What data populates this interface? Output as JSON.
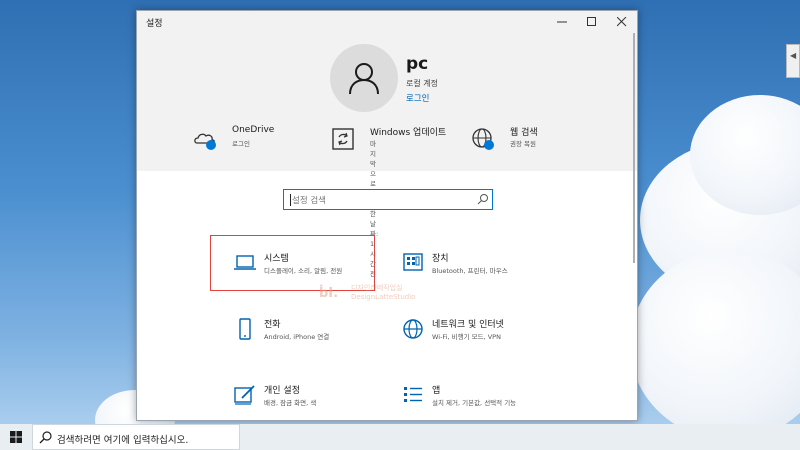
{
  "window": {
    "title": "설정"
  },
  "user": {
    "name": "pc",
    "account_type": "로컬 계정",
    "signin_link": "로그인"
  },
  "header_items": [
    {
      "title": "OneDrive",
      "subtitle": "로그인",
      "icon": "onedrive-cloud-icon"
    },
    {
      "title": "Windows 업데이트",
      "subtitle": "마지막으로 확인한 날짜:\n1시간 전",
      "icon": "windows-update-icon"
    },
    {
      "title": "웹 검색",
      "subtitle": "권장 복원",
      "icon": "globe-icon"
    }
  ],
  "search": {
    "placeholder": "설정 검색"
  },
  "categories": [
    {
      "title": "시스템",
      "subtitle": "디스플레이, 소리, 알림, 전원",
      "icon": "laptop-icon"
    },
    {
      "title": "장치",
      "subtitle": "Bluetooth, 프린터, 마우스",
      "icon": "keyboard-icon"
    },
    {
      "title": "전화",
      "subtitle": "Android, iPhone 연결",
      "icon": "phone-icon"
    },
    {
      "title": "네트워크 및 인터넷",
      "subtitle": "Wi-Fi, 비행기 모드, VPN",
      "icon": "globe-icon"
    },
    {
      "title": "개인 설정",
      "subtitle": "배경, 잠금 화면, 색",
      "icon": "personalization-icon"
    },
    {
      "title": "앱",
      "subtitle": "설치 제거, 기본값, 선택적 기능",
      "icon": "apps-list-icon"
    }
  ],
  "watermark": {
    "line1": "디자인라떼작업실",
    "line2": "DesignLatteStudio"
  },
  "taskbar": {
    "search_text": "검색하려면 여기에 입력하십시오."
  },
  "colors": {
    "accent": "#0078d7",
    "link": "#0063b1",
    "highlight": "#e0443c",
    "header_bg": "#f2f2f2"
  }
}
